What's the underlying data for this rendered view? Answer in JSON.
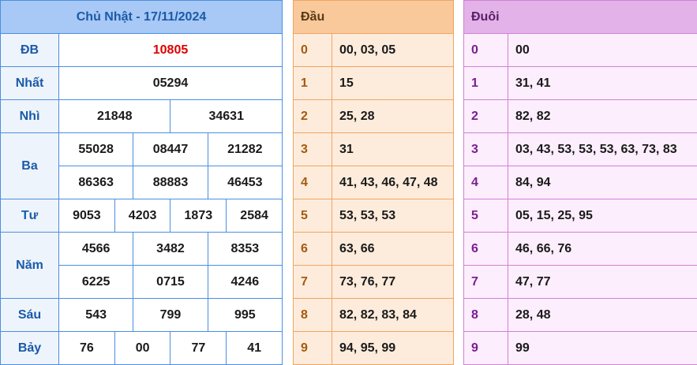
{
  "results": {
    "title": "Chủ Nhật - 17/11/2024",
    "special": {
      "label": "ĐB",
      "value": "10805"
    },
    "first": {
      "label": "Nhất",
      "value": "05294"
    },
    "second": {
      "label": "Nhì",
      "values": [
        "21848",
        "34631"
      ]
    },
    "third": {
      "label": "Ba",
      "values": [
        "55028",
        "08447",
        "21282",
        "86363",
        "88883",
        "46453"
      ]
    },
    "fourth": {
      "label": "Tư",
      "values": [
        "9053",
        "4203",
        "1873",
        "2584"
      ]
    },
    "fifth": {
      "label": "Năm",
      "values": [
        "4566",
        "3482",
        "8353",
        "6225",
        "0715",
        "4246"
      ]
    },
    "sixth": {
      "label": "Sáu",
      "values": [
        "543",
        "799",
        "995"
      ]
    },
    "seventh": {
      "label": "Bảy",
      "values": [
        "76",
        "00",
        "77",
        "41"
      ]
    }
  },
  "dau": {
    "title": "Đầu",
    "rows": [
      {
        "digit": "0",
        "values": "00, 03, 05"
      },
      {
        "digit": "1",
        "values": "15"
      },
      {
        "digit": "2",
        "values": "25, 28"
      },
      {
        "digit": "3",
        "values": "31"
      },
      {
        "digit": "4",
        "values": "41, 43, 46, 47, 48"
      },
      {
        "digit": "5",
        "values": "53, 53, 53"
      },
      {
        "digit": "6",
        "values": "63, 66"
      },
      {
        "digit": "7",
        "values": "73, 76, 77"
      },
      {
        "digit": "8",
        "values": "82, 82, 83, 84"
      },
      {
        "digit": "9",
        "values": "94, 95, 99"
      }
    ]
  },
  "duoi": {
    "title": "Đuôi",
    "rows": [
      {
        "digit": "0",
        "values": "00"
      },
      {
        "digit": "1",
        "values": "31, 41"
      },
      {
        "digit": "2",
        "values": "82, 82"
      },
      {
        "digit": "3",
        "values": "03, 43, 53, 53, 53, 63, 73, 83"
      },
      {
        "digit": "4",
        "values": "84, 94"
      },
      {
        "digit": "5",
        "values": "05, 15, 25, 95"
      },
      {
        "digit": "6",
        "values": "46, 66, 76"
      },
      {
        "digit": "7",
        "values": "47, 77"
      },
      {
        "digit": "8",
        "values": "28, 48"
      },
      {
        "digit": "9",
        "values": "99"
      }
    ]
  }
}
